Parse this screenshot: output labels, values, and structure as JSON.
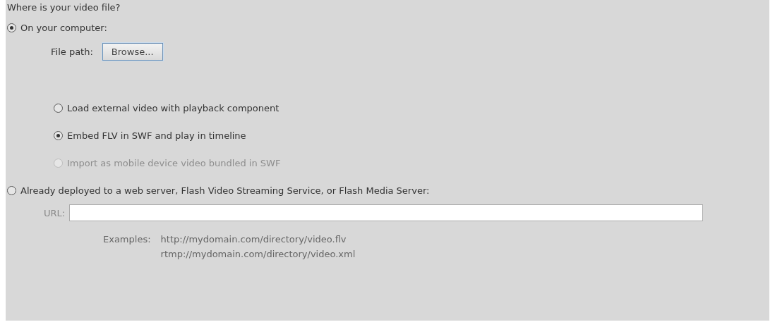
{
  "question": "Where is your video file?",
  "location_options": [
    {
      "kind": "computer",
      "label": "On your computer:",
      "selected": true,
      "file_path": {
        "label": "File path:",
        "button": "Browse..."
      },
      "sub_options": [
        {
          "label": "Load external video with playback component",
          "selected": false,
          "disabled": false
        },
        {
          "label": "Embed FLV in SWF and play in timeline",
          "selected": true,
          "disabled": false
        },
        {
          "label": "Import as mobile device video bundled in SWF",
          "selected": false,
          "disabled": true
        }
      ]
    },
    {
      "kind": "server",
      "label": "Already deployed to a web server, Flash Video Streaming Service, or Flash Media Server:",
      "selected": false,
      "url": {
        "label": "URL:",
        "disabled": true
      },
      "examples": {
        "label": "Examples:",
        "lines": [
          "http://mydomain.com/directory/video.flv",
          "rtmp://mydomain.com/directory/video.xml"
        ]
      }
    }
  ]
}
